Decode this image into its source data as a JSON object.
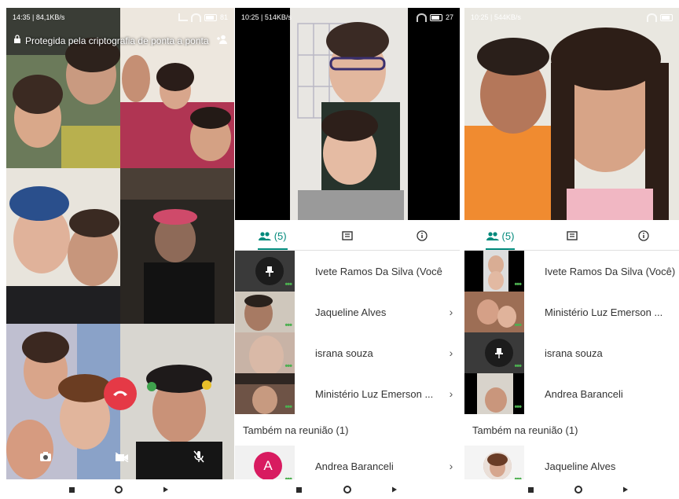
{
  "phone1": {
    "status": {
      "time_speed": "14:35 | 84,1KB/s",
      "battery": "81"
    },
    "banner_text": "Protegida pela criptografia de ponta a ponta"
  },
  "phone2": {
    "status": {
      "time_speed": "10:25 | 514KB/s",
      "battery": "27"
    },
    "tabs": {
      "participants_count": "(5)",
      "active": "participants"
    },
    "participants": [
      {
        "name": "Ivete Ramos Da Silva (Você)",
        "chevron": false
      },
      {
        "name": "Jaqueline Alves",
        "chevron": true
      },
      {
        "name": "israna souza",
        "chevron": true
      },
      {
        "name": "Ministério Luz Emerson ...",
        "chevron": true
      }
    ],
    "also_in_meeting_label": "Também na reunião (1)",
    "also": [
      {
        "name": "Andrea Baranceli",
        "avatar_letter": "A",
        "chevron": true
      }
    ]
  },
  "phone3": {
    "status": {
      "time_speed": "10:25 | 544KB/s"
    },
    "tabs": {
      "participants_count": "(5)",
      "active": "participants"
    },
    "participants": [
      {
        "name": "Ivete Ramos Da Silva (Você)"
      },
      {
        "name": "Ministério Luz Emerson ..."
      },
      {
        "name": "israna souza"
      },
      {
        "name": "Andrea Baranceli"
      }
    ],
    "also_in_meeting_label": "Também na reunião (1)",
    "also": [
      {
        "name": "Jaqueline Alves"
      }
    ]
  },
  "colors": {
    "accent": "#00897b",
    "end_call": "#e53946",
    "online_dots": "#4caf50",
    "avatar_a": "#d81b60"
  },
  "icons": [
    "lock-icon",
    "add-person-icon",
    "people-icon",
    "chat-icon",
    "info-icon",
    "pin-icon",
    "end-call-icon",
    "camera-switch-icon",
    "video-off-icon",
    "mic-off-icon",
    "chevron-right-icon"
  ]
}
